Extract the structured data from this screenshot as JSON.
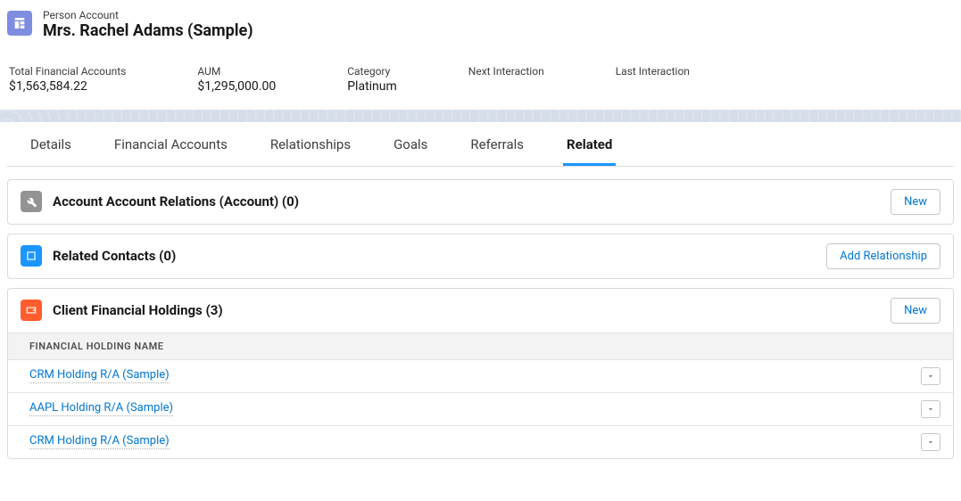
{
  "header": {
    "overline": "Person Account",
    "title": "Mrs. Rachel Adams (Sample)"
  },
  "metrics": [
    {
      "label": "Total Financial Accounts",
      "value": "$1,563,584.22"
    },
    {
      "label": "AUM",
      "value": "$1,295,000.00"
    },
    {
      "label": "Category",
      "value": "Platinum"
    },
    {
      "label": "Next Interaction",
      "value": ""
    },
    {
      "label": "Last Interaction",
      "value": ""
    }
  ],
  "tabs": [
    {
      "label": "Details",
      "active": false
    },
    {
      "label": "Financial Accounts",
      "active": false
    },
    {
      "label": "Relationships",
      "active": false
    },
    {
      "label": "Goals",
      "active": false
    },
    {
      "label": "Referrals",
      "active": false
    },
    {
      "label": "Related",
      "active": true
    }
  ],
  "cards": {
    "relations": {
      "title": "Account Account Relations (Account) (0)",
      "button": "New"
    },
    "contacts": {
      "title": "Related Contacts (0)",
      "button": "Add Relationship"
    },
    "holdings": {
      "title": "Client Financial Holdings (3)",
      "button": "New",
      "column_header": "FINANCIAL HOLDING NAME",
      "rows": [
        {
          "name": "CRM Holding R/A (Sample)"
        },
        {
          "name": "AAPL Holding R/A (Sample)"
        },
        {
          "name": "CRM Holding R/A (Sample)"
        }
      ]
    }
  }
}
